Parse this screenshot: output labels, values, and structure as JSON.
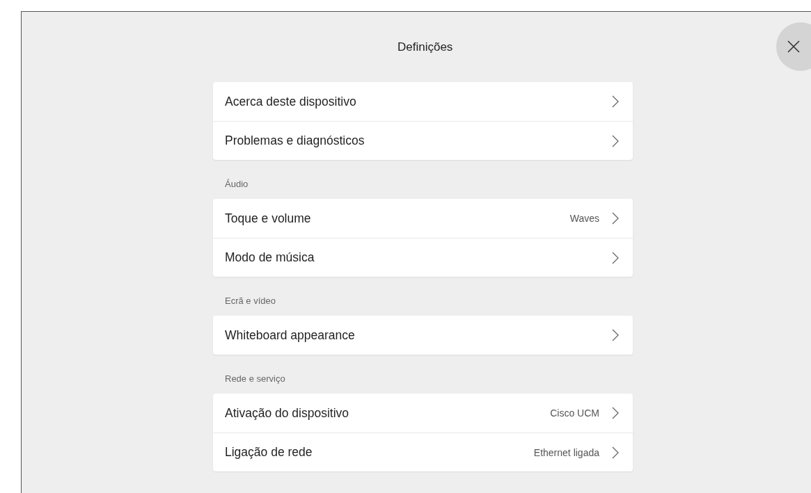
{
  "title": "Definições",
  "sections": [
    {
      "items": [
        {
          "label": "Acerca deste dispositivo"
        },
        {
          "label": "Problemas e diagnósticos"
        }
      ]
    },
    {
      "heading": "Áudio",
      "items": [
        {
          "label": "Toque e volume",
          "value": "Waves"
        },
        {
          "label": "Modo de música"
        }
      ]
    },
    {
      "heading": "Ecrã e vídeo",
      "items": [
        {
          "label": "Whiteboard appearance"
        }
      ]
    },
    {
      "heading": "Rede e serviço",
      "items": [
        {
          "label": "Ativação do dispositivo",
          "value": "Cisco UCM"
        },
        {
          "label": "Ligação de rede",
          "value": "Ethernet ligada"
        }
      ]
    }
  ]
}
